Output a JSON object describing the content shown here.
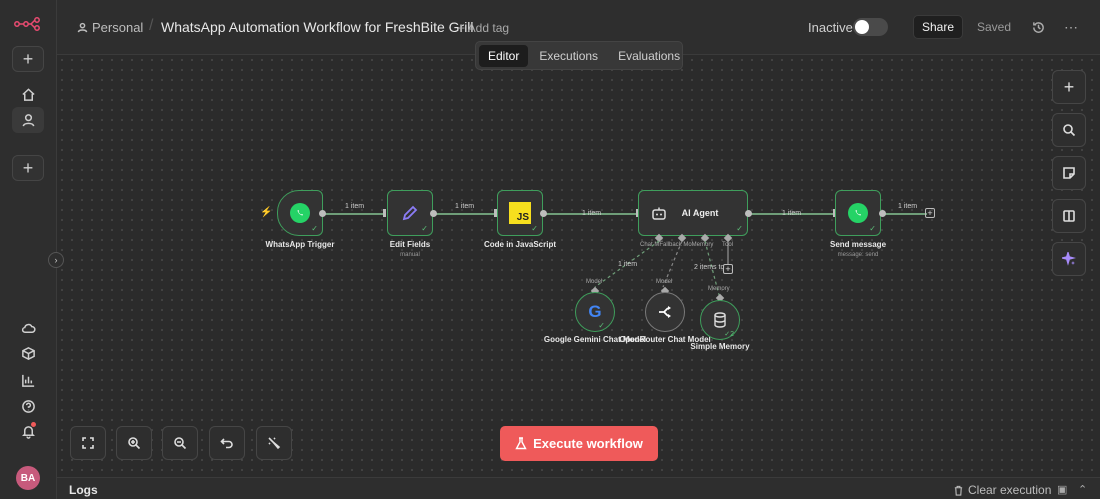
{
  "header": {
    "project": "Personal",
    "workflow_title": "WhatsApp Automation Workflow for FreshBite Grill",
    "add_tag": "+ Add tag",
    "status_label": "Inactive",
    "share_label": "Share",
    "saved_label": "Saved"
  },
  "tabs": [
    {
      "label": "Editor",
      "active": true
    },
    {
      "label": "Executions",
      "active": false
    },
    {
      "label": "Evaluations",
      "active": false
    }
  ],
  "nodes": {
    "trigger": {
      "label": "WhatsApp Trigger"
    },
    "edit_fields": {
      "label": "Edit Fields",
      "sub": "manual"
    },
    "code": {
      "label": "Code in JavaScript",
      "icon_text": "JS"
    },
    "agent": {
      "label": "AI Agent",
      "ports": "Chat MFallback MoMemory",
      "tool_port": "Tool"
    },
    "send": {
      "label": "Send message",
      "sub": "message: send"
    },
    "gemini": {
      "label": "Google Gemini Chat Model",
      "port": "Model"
    },
    "openrouter": {
      "label": "OpenRouter Chat Model",
      "port": "Model"
    },
    "memory": {
      "label": "Simple Memory",
      "port": "Memory",
      "count": "2"
    }
  },
  "edges": {
    "e1": "1 item",
    "e2": "1 item",
    "e3": "1 item",
    "e4": "1 item",
    "e5": "1 item",
    "model_edge": "1 item",
    "memory_edge": "2 items to"
  },
  "execute_label": "Execute workflow",
  "logs": {
    "title": "Logs",
    "clear_label": "Clear execution"
  },
  "user": {
    "initials": "BA"
  },
  "colors": {
    "accent": "#ef5a5a",
    "node_success": "#3f9e5c",
    "whatsapp": "#25d366",
    "js": "#f7df1e",
    "avatar": "#c75a7c"
  }
}
